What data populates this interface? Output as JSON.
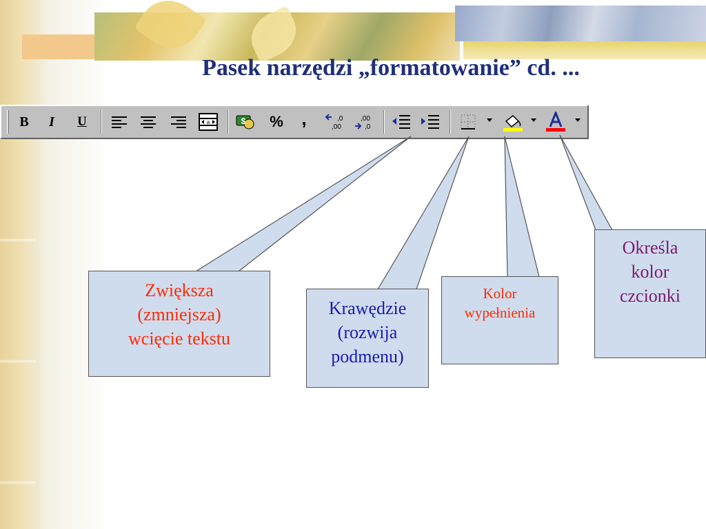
{
  "title": "Pasek narzędzi „formatowanie” cd. ...",
  "toolbar": {
    "buttons": [
      {
        "id": "bold",
        "glyph": "B"
      },
      {
        "id": "italic",
        "glyph": "I"
      },
      {
        "id": "underline",
        "glyph": "U"
      },
      {
        "id": "currency",
        "glyph": "$"
      },
      {
        "id": "percent",
        "glyph": "%"
      },
      {
        "id": "comma",
        "glyph": ","
      },
      {
        "id": "increase-decimal",
        "glyph": "←.0 .00"
      },
      {
        "id": "decrease-decimal",
        "glyph": ".00 →.0"
      },
      {
        "id": "font-color-letter",
        "glyph": "A"
      }
    ],
    "icons": [
      "bold-icon",
      "italic-icon",
      "underline-icon",
      "align-left-icon",
      "align-center-icon",
      "align-right-icon",
      "merge-center-icon",
      "currency-icon",
      "percent-icon",
      "comma-icon",
      "increase-decimal-icon",
      "decrease-decimal-icon",
      "decrease-indent-icon",
      "increase-indent-icon",
      "borders-icon",
      "fill-color-icon",
      "font-color-icon"
    ],
    "fill_color_swatch": "#ffff00",
    "font_color_swatch": "#ff0000"
  },
  "callouts": [
    {
      "id": "indent",
      "lines": [
        "Zwiększa",
        "(zmniejsza)",
        "wcięcie tekstu"
      ],
      "color": "#ff2a00"
    },
    {
      "id": "borders",
      "lines": [
        "Krawędzie",
        "(rozwija",
        "podmenu)"
      ],
      "color": "#1a1ab0"
    },
    {
      "id": "fill",
      "lines": [
        "Kolor",
        "wypełnienia"
      ],
      "color": "#ff2a00"
    },
    {
      "id": "font-color",
      "lines": [
        "Określa",
        "kolor",
        "czcionki"
      ],
      "color": "#7a1a6e"
    }
  ],
  "colors": {
    "title": "#1f2f7a",
    "callout_bg": "#cfdcee",
    "toolbar_bg": "#c0c0c0"
  }
}
